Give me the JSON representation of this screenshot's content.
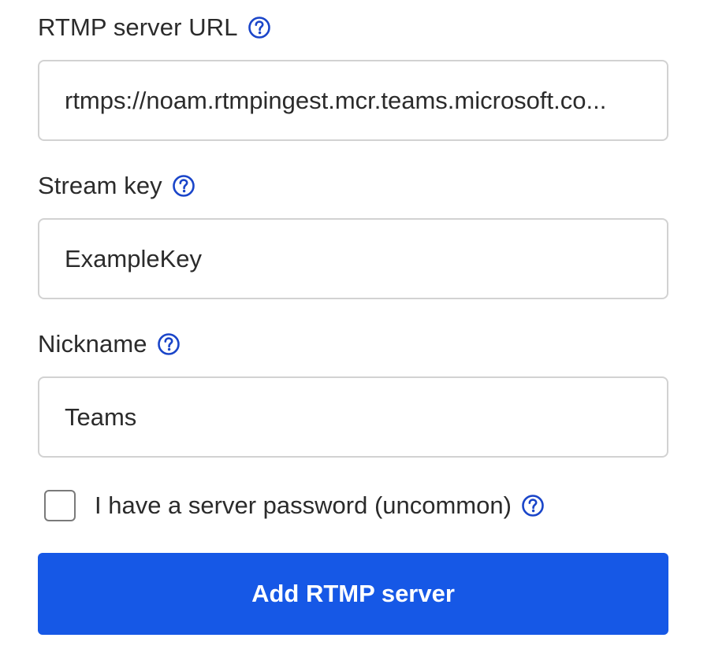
{
  "colors": {
    "accent": "#1658e6",
    "help_icon": "#1a45c9",
    "input_border": "#d2d2d2",
    "text": "#2b2b2b"
  },
  "fields": [
    {
      "label": "RTMP server URL",
      "help_icon": "question-circle-icon",
      "value": "rtmps://noam.rtmpingest.mcr.teams.microsoft.co..."
    },
    {
      "label": "Stream key",
      "help_icon": "question-circle-icon",
      "value": "ExampleKey"
    },
    {
      "label": "Nickname",
      "help_icon": "question-circle-icon",
      "value": "Teams"
    }
  ],
  "password_option": {
    "label": "I have a server password (uncommon)",
    "checked": false,
    "help_icon": "question-circle-icon"
  },
  "submit_button": {
    "label": "Add RTMP server"
  }
}
